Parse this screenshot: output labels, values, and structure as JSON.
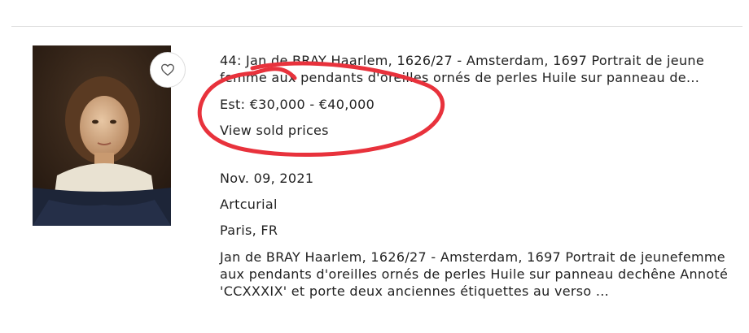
{
  "lot": {
    "title": "44: Jan de BRAY Haarlem, 1626/27 - Amsterdam, 1697 Portrait de jeune femme aux pendants d'oreilles ornés de perles Huile sur panneau de...",
    "estimate": "Est: €30,000 - €40,000",
    "sold_prices_link": "View sold prices",
    "date": "Nov. 09, 2021",
    "auction_house": "Artcurial",
    "location": "Paris, FR",
    "description": "Jan de BRAY Haarlem, 1626/27 - Amsterdam, 1697 Portrait de jeunefemme aux pendants d'oreilles ornés de perles Huile sur panneau dechêne Annoté 'CCXXXIX' et porte deux anciennes étiquettes au verso ..."
  },
  "icons": {
    "favorite": "heart-icon"
  },
  "colors": {
    "annotation": "#e8323c",
    "divider": "#dedede"
  }
}
